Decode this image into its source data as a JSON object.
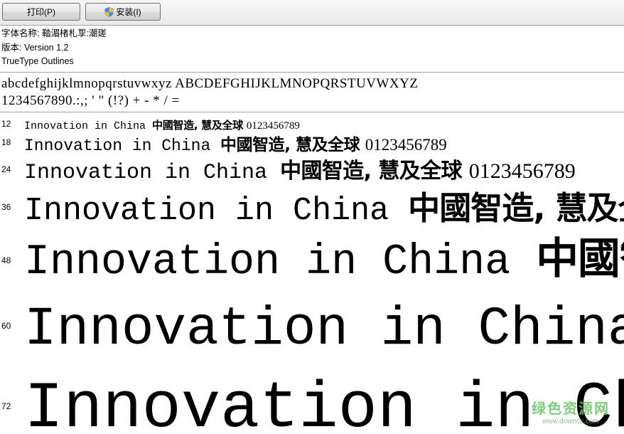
{
  "toolbar": {
    "print_label": "打印(P)",
    "install_label": "安装(I)"
  },
  "info": {
    "font_name_line": "字体名称: 鞜湄楮札孠:潮瑳",
    "version_line": "版本: Version 1.2",
    "outline_type": "TrueType Outlines"
  },
  "charset": {
    "line1": "abcdefghijklmnopqrstuvwxyz ABCDEFGHIJKLMNOPQRSTUVWXYZ",
    "line2": "1234567890.:,; ' \" (!?) + - * / ="
  },
  "samples": {
    "latin": "Innovation in China ",
    "cjk": "中國智造, 慧及全球 ",
    "digits": "0123456789",
    "rows": [
      {
        "size": "12"
      },
      {
        "size": "18"
      },
      {
        "size": "24"
      },
      {
        "size": "36"
      },
      {
        "size": "48"
      },
      {
        "size": "60"
      },
      {
        "size": "72"
      }
    ]
  },
  "watermark": {
    "main": "绿色资源网",
    "url": "www.downcc.com"
  },
  "colors": {
    "toolbar_bg": "#ececec",
    "divider": "#a0a0a0",
    "watermark": "#6cc36c"
  }
}
